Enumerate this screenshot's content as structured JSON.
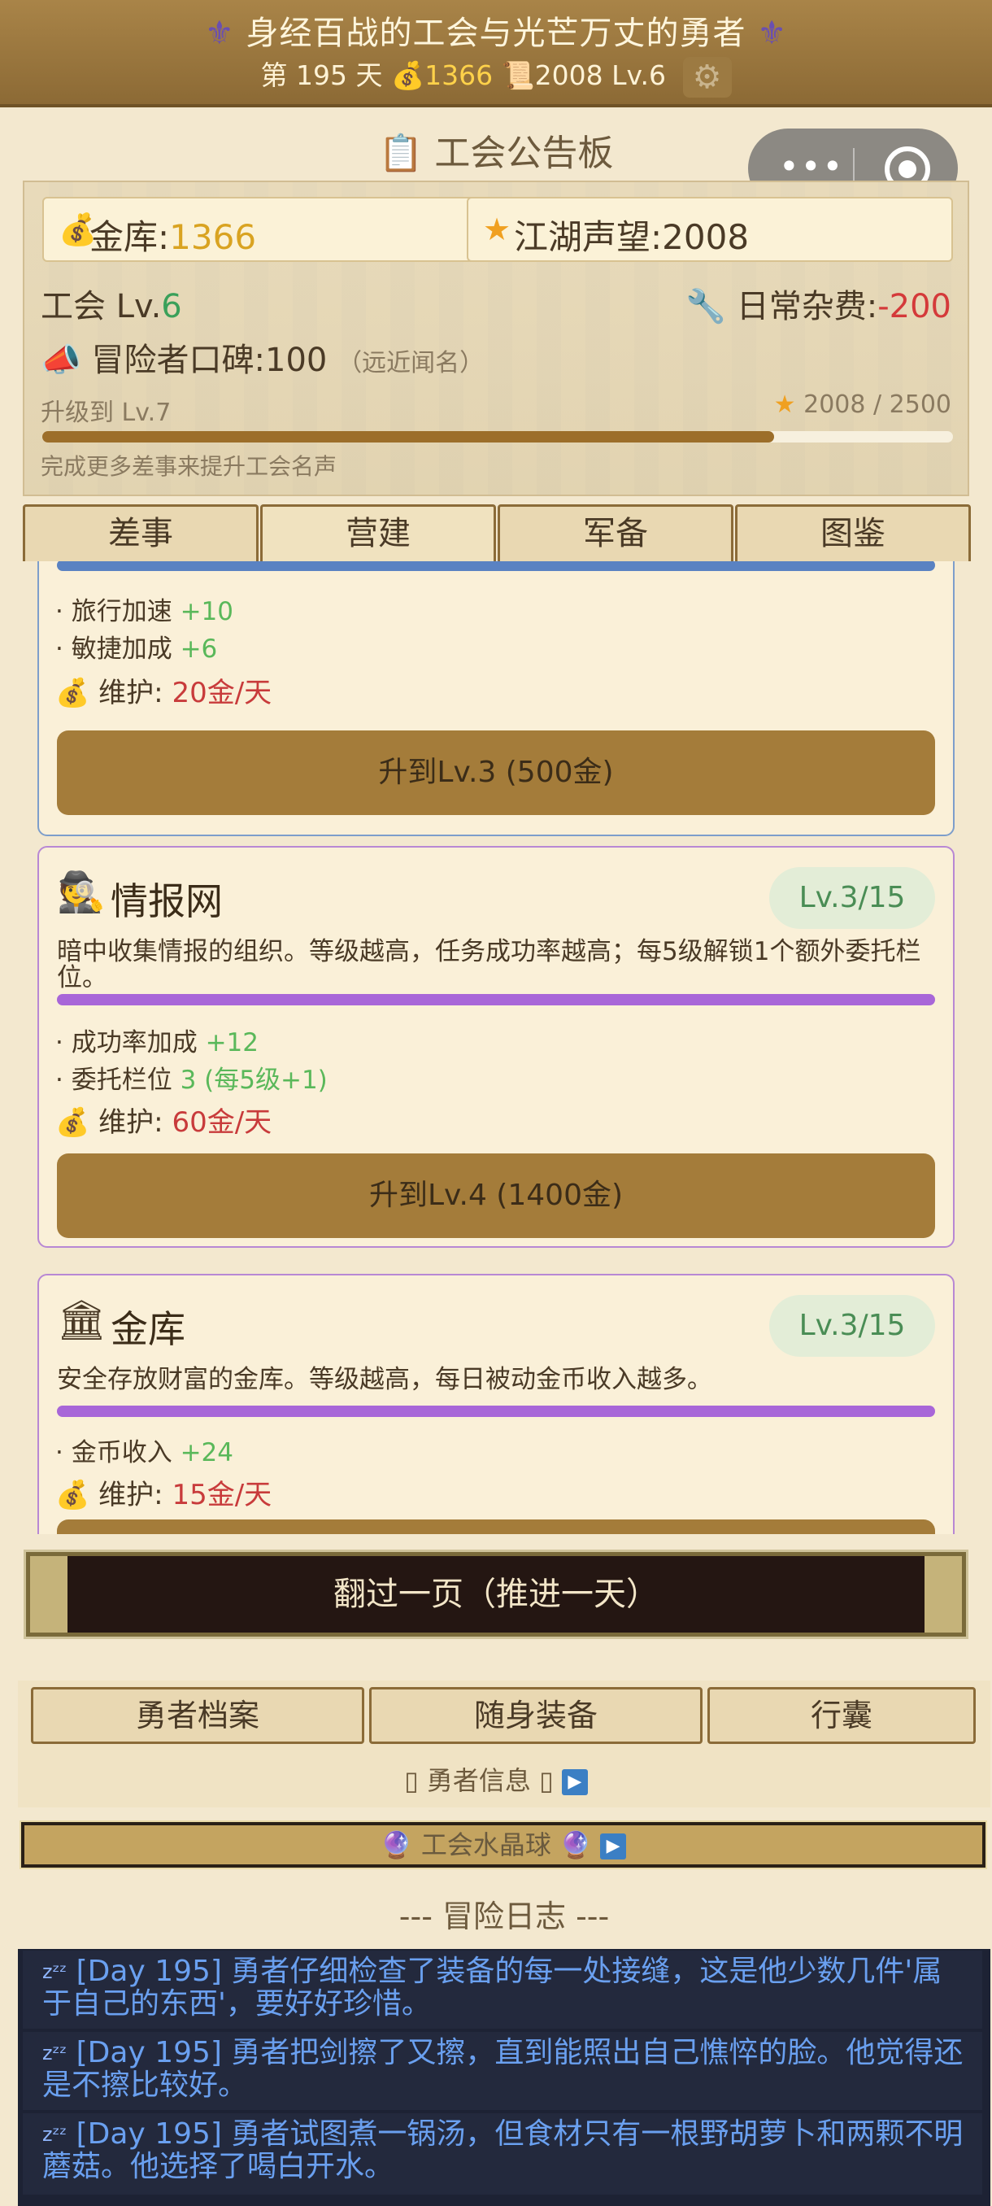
{
  "header": {
    "title": "身经百战的工会与光芒万丈的勇者",
    "fleur": "⚜",
    "day_prefix": "第",
    "day": "195",
    "day_suffix": "天",
    "gold": "1366",
    "fame": "2008",
    "level": "Lv.6"
  },
  "board": {
    "title": "工会公告板",
    "gold_label": "金库:",
    "gold_value": "1366",
    "fame_label": "江湖声望:",
    "fame_value": "2008",
    "guild_label": "工会 Lv.",
    "guild_level": "6",
    "daily_label": "日常杂费:",
    "daily_value": "-200",
    "reputation_label": "冒险者口碑:",
    "reputation_value": "100",
    "reputation_note": "（远近闻名）",
    "upgrade_label": "升级到 Lv.7",
    "progress_text": "2008 / 2500",
    "progress_fraction": 0.8032,
    "hint": "完成更多差事来提升工会名声"
  },
  "tabs": [
    "差事",
    "营建",
    "军备",
    "图鉴"
  ],
  "cards": {
    "c1": {
      "stat1_label": "· 旅行加速",
      "stat1_value": "+10",
      "stat2_label": "· 敏捷加成",
      "stat2_value": "+6",
      "upkeep_label": "维护:",
      "upkeep_value": "20金/天",
      "button": "升到Lv.3 (500金)"
    },
    "c2": {
      "icon": "🕵",
      "name": "情报网",
      "level": "Lv.3/15",
      "desc": "暗中收集情报的组织。等级越高，任务成功率越高；每5级解锁1个额外委托栏位。",
      "stat1_label": "· 成功率加成",
      "stat1_value": "+12",
      "stat2_label": "· 委托栏位",
      "stat2_value": "3 (每5级+1)",
      "upkeep_label": "维护:",
      "upkeep_value": "60金/天",
      "button": "升到Lv.4 (1400金)"
    },
    "c3": {
      "icon": "🏛",
      "name": "金库",
      "level": "Lv.3/15",
      "desc": "安全存放财富的金库。等级越高，每日被动金币收入越多。",
      "stat1_label": "· 金币收入",
      "stat1_value": "+24",
      "upkeep_label": "维护:",
      "upkeep_value": "15金/天"
    }
  },
  "advance_button": "翻过一页（推进一天）",
  "hero_tabs": [
    "勇者档案",
    "随身装备",
    "行囊"
  ],
  "hero_info": "勇者信息",
  "crystal_ball": "工会水晶球",
  "log": {
    "title": "--- 冒险日志 ---",
    "entries": [
      "[Day 195] 勇者仔细检查了装备的每一处接缝，这是他少数几件'属于自己的东西'，要好好珍惜。",
      "[Day 195] 勇者把剑擦了又擦，直到能照出自己憔悴的脸。他觉得还是不擦比较好。",
      "[Day 195] 勇者试图煮一锅汤，但食材只有一根野胡萝卜和两颗不明蘑菇。他选择了喝白开水。"
    ]
  }
}
